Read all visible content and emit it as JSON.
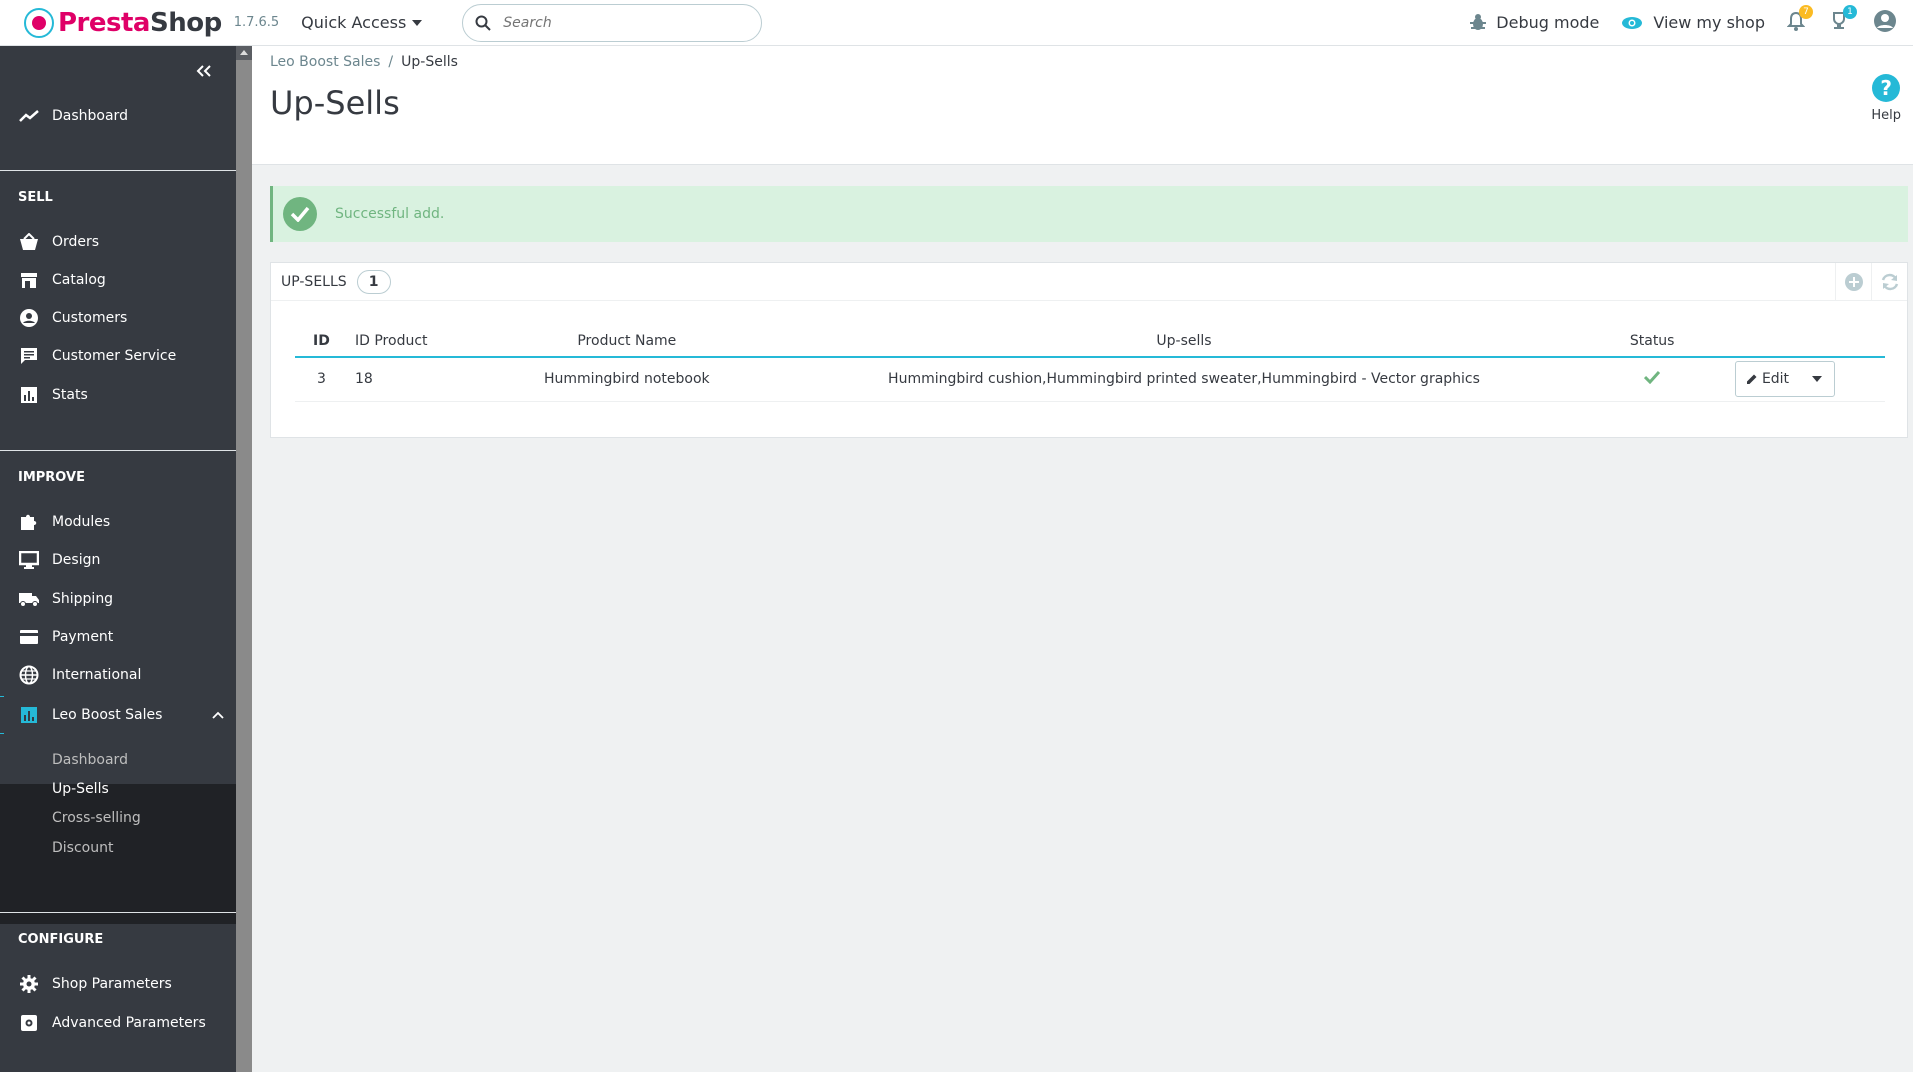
{
  "header": {
    "logo_text_a": "Presta",
    "logo_text_b": "Shop",
    "version": "1.7.6.5",
    "quick_access": "Quick Access",
    "search_placeholder": "Search",
    "debug_mode": "Debug mode",
    "view_shop": "View my shop",
    "notifications_count": "7",
    "trophy_count": "1"
  },
  "sidebar": {
    "dashboard": "Dashboard",
    "sections": {
      "sell": "SELL",
      "improve": "IMPROVE",
      "configure": "CONFIGURE"
    },
    "sell_items": [
      "Orders",
      "Catalog",
      "Customers",
      "Customer Service",
      "Stats"
    ],
    "improve_items": [
      "Modules",
      "Design",
      "Shipping",
      "Payment",
      "International"
    ],
    "active_item": "Leo Boost Sales",
    "submenu": [
      "Dashboard",
      "Up-Sells",
      "Cross-selling",
      "Discount"
    ],
    "configure_items": [
      "Shop Parameters",
      "Advanced Parameters"
    ]
  },
  "page": {
    "breadcrumb_parent": "Leo Boost Sales",
    "breadcrumb_current": "Up-Sells",
    "title": "Up-Sells",
    "help": "Help"
  },
  "alert": {
    "text": "Successful add."
  },
  "panel": {
    "title": "UP-SELLS",
    "count": "1",
    "columns": [
      "ID",
      "ID Product",
      "Product Name",
      "Up-sells",
      "Status"
    ],
    "rows": [
      {
        "id": "3",
        "id_product": "18",
        "product_name": "Hummingbird notebook",
        "upsells": "Hummingbird cushion,Hummingbird printed sweater,Hummingbird - Vector graphics",
        "status": "enabled",
        "action": "Edit"
      }
    ]
  },
  "colors": {
    "accent": "#25b9d7",
    "brand": "#df0067",
    "success": "#70b580",
    "sidebar": "#363a41"
  }
}
